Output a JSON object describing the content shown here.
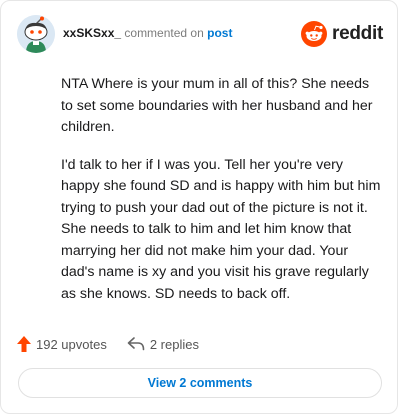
{
  "comment": {
    "username": "xxSKSxx_",
    "action_text": "commented on",
    "target_link": "post",
    "paragraphs": [
      "NTA Where is your mum in all of this? She needs to set some boundaries with her husband and her children.",
      "I'd talk to her if I was you. Tell her you're very happy she found SD and is happy with him but him trying to push your dad out of the picture is not it. She needs to talk to him and let him know that marrying her did not make him your dad. Your dad's name is xy and you visit his grave regularly as she knows. SD needs to back off."
    ],
    "upvotes": "192 upvotes",
    "replies": "2 replies",
    "view_comments": "View 2 comments"
  },
  "brand": {
    "name": "reddit",
    "color": "#ff4500"
  },
  "icons": {
    "avatar": "snoo-avatar",
    "logo": "reddit-logo-icon",
    "upvote": "upvote-arrow-icon",
    "reply": "reply-arrow-icon"
  },
  "colors": {
    "link": "#0079d3",
    "upvote": "#ff4500"
  }
}
